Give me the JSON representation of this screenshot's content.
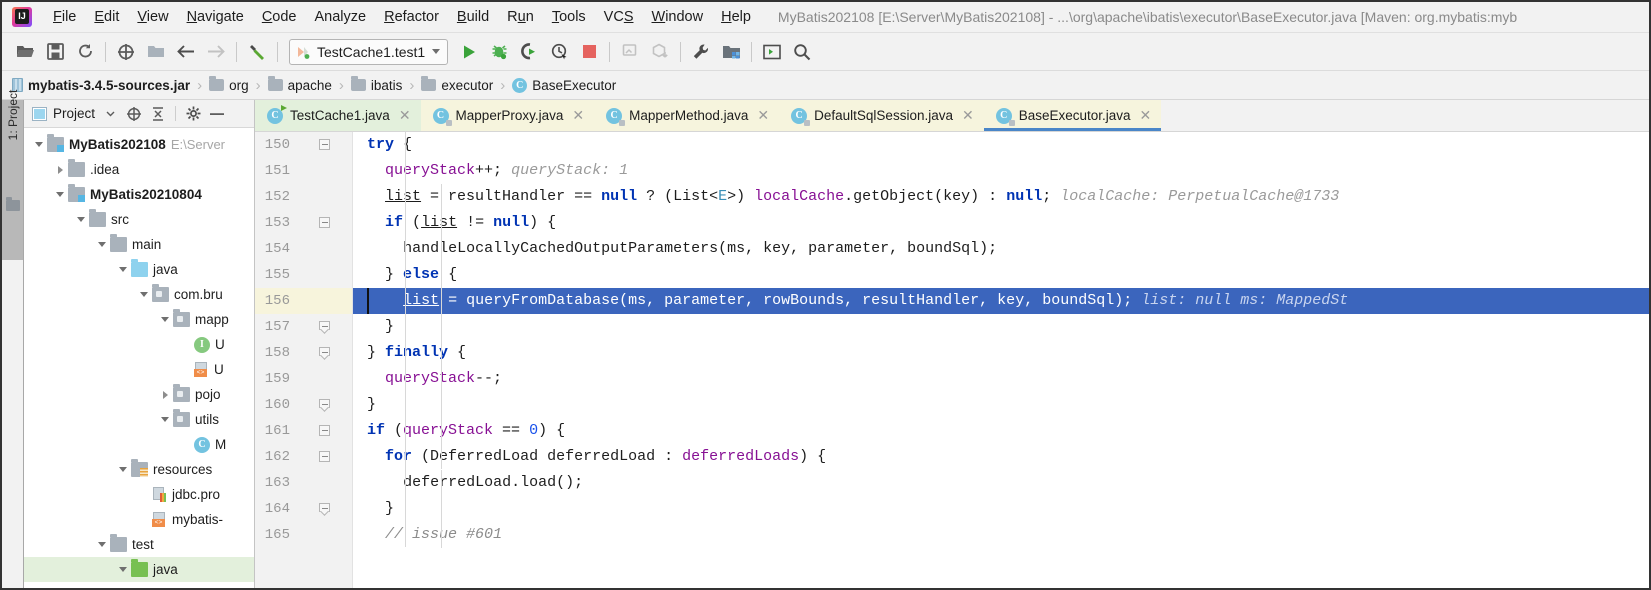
{
  "window": {
    "title": "MyBatis202108 [E:\\Server\\MyBatis202108] - ...\\org\\apache\\ibatis\\executor\\BaseExecutor.java [Maven: org.mybatis:myb",
    "logo_letters": "IJ"
  },
  "menubar": {
    "items": [
      {
        "label": "File",
        "mnemonic": "F"
      },
      {
        "label": "Edit",
        "mnemonic": "E"
      },
      {
        "label": "View",
        "mnemonic": "V"
      },
      {
        "label": "Navigate",
        "mnemonic": "N"
      },
      {
        "label": "Code",
        "mnemonic": "C"
      },
      {
        "label": "Analyze",
        "mnemonic": ""
      },
      {
        "label": "Refactor",
        "mnemonic": "R"
      },
      {
        "label": "Build",
        "mnemonic": "B"
      },
      {
        "label": "Run",
        "mnemonic": "u"
      },
      {
        "label": "Tools",
        "mnemonic": "T"
      },
      {
        "label": "VCS",
        "mnemonic": "S"
      },
      {
        "label": "Window",
        "mnemonic": "W"
      },
      {
        "label": "Help",
        "mnemonic": "H"
      }
    ]
  },
  "toolbar": {
    "icons": [
      "open-folder-icon",
      "save-all-icon",
      "sync-icon",
      "target-icon",
      "folder-icon",
      "back-arrow-icon",
      "forward-arrow-icon",
      "build-hammer-icon"
    ],
    "run_config": {
      "label": "TestCache1.test1",
      "icon": "run-config-icon"
    },
    "right_icons": [
      "run-icon",
      "debug-icon",
      "run-with-coverage-icon",
      "profile-icon",
      "stop-icon",
      "update-app-icon",
      "package-download-icon",
      "settings-wrench-icon",
      "project-structure-icon",
      "terminal-icon",
      "search-icon"
    ]
  },
  "breadcrumb": {
    "items": [
      {
        "label": "mybatis-3.4.5-sources.jar",
        "icon": "jar-icon"
      },
      {
        "label": "org",
        "icon": "folder-icon"
      },
      {
        "label": "apache",
        "icon": "folder-icon"
      },
      {
        "label": "ibatis",
        "icon": "folder-icon"
      },
      {
        "label": "executor",
        "icon": "folder-icon"
      },
      {
        "label": "BaseExecutor",
        "icon": "class-icon"
      }
    ],
    "separator": "›"
  },
  "left_strip": {
    "project_tab": "1: Project",
    "favorites_icon": "folder-icon"
  },
  "project_panel": {
    "title": "Project",
    "icons": [
      "project-view-icon",
      "locate-icon",
      "collapse-all-icon",
      "gear-icon",
      "minimize-icon"
    ],
    "tree": [
      {
        "indent": 0,
        "arrow": "down",
        "icon": "module-icon",
        "label": "MyBatis202108",
        "bold": true,
        "path": "E:\\Server",
        "selected": false
      },
      {
        "indent": 1,
        "arrow": "right",
        "icon": "folder-icon",
        "label": ".idea",
        "bold": false,
        "path": "",
        "selected": false
      },
      {
        "indent": 1,
        "arrow": "down",
        "icon": "module-icon",
        "label": "MyBatis20210804",
        "bold": true,
        "path": "",
        "selected": false
      },
      {
        "indent": 2,
        "arrow": "down",
        "icon": "folder-icon",
        "label": "src",
        "bold": false,
        "path": "",
        "selected": false
      },
      {
        "indent": 3,
        "arrow": "down",
        "icon": "folder-icon",
        "label": "main",
        "bold": false,
        "path": "",
        "selected": false
      },
      {
        "indent": 4,
        "arrow": "down",
        "icon": "source-root-icon",
        "label": "java",
        "bold": false,
        "path": "",
        "selected": false
      },
      {
        "indent": 5,
        "arrow": "down",
        "icon": "package-icon",
        "label": "com.bru",
        "bold": false,
        "path": "",
        "selected": false
      },
      {
        "indent": 6,
        "arrow": "down",
        "icon": "package-icon",
        "label": "mapp",
        "bold": false,
        "path": "",
        "selected": false
      },
      {
        "indent": 7,
        "arrow": "none",
        "icon": "interface-icon",
        "label": "U",
        "bold": false,
        "path": "",
        "selected": false
      },
      {
        "indent": 7,
        "arrow": "none",
        "icon": "xml-file-icon",
        "label": "U",
        "bold": false,
        "path": "",
        "selected": false
      },
      {
        "indent": 6,
        "arrow": "right",
        "icon": "package-icon",
        "label": "pojo",
        "bold": false,
        "path": "",
        "selected": false
      },
      {
        "indent": 6,
        "arrow": "down",
        "icon": "package-icon",
        "label": "utils",
        "bold": false,
        "path": "",
        "selected": false
      },
      {
        "indent": 7,
        "arrow": "none",
        "icon": "class-icon",
        "label": "M",
        "bold": false,
        "path": "",
        "selected": false
      },
      {
        "indent": 4,
        "arrow": "down",
        "icon": "resource-root-icon",
        "label": "resources",
        "bold": false,
        "path": "",
        "selected": false
      },
      {
        "indent": 5,
        "arrow": "none",
        "icon": "properties-file-icon",
        "label": "jdbc.pro",
        "bold": false,
        "path": "",
        "selected": false
      },
      {
        "indent": 5,
        "arrow": "none",
        "icon": "xml-file-icon",
        "label": "mybatis-",
        "bold": false,
        "path": "",
        "selected": false
      },
      {
        "indent": 3,
        "arrow": "down",
        "icon": "folder-icon",
        "label": "test",
        "bold": false,
        "path": "",
        "selected": false
      },
      {
        "indent": 4,
        "arrow": "down",
        "icon": "test-source-root-icon",
        "label": "java",
        "bold": false,
        "path": "",
        "selected": true
      }
    ]
  },
  "editor_tabs": [
    {
      "label": "TestCache1.java",
      "icon": "test-class-icon",
      "closable": true,
      "state": "green",
      "active": false
    },
    {
      "label": "MapperProxy.java",
      "icon": "readonly-class-icon",
      "closable": true,
      "state": "yellow",
      "active": false
    },
    {
      "label": "MapperMethod.java",
      "icon": "readonly-class-icon",
      "closable": true,
      "state": "yellow",
      "active": false
    },
    {
      "label": "DefaultSqlSession.java",
      "icon": "readonly-class-icon",
      "closable": true,
      "state": "yellow",
      "active": false
    },
    {
      "label": "BaseExecutor.java",
      "icon": "readonly-class-icon",
      "closable": true,
      "state": "yellow",
      "active": true
    }
  ],
  "code": {
    "first_line": 150,
    "highlighted_line": 156,
    "lines": [
      {
        "n": 150,
        "fold": "start",
        "text": "try {"
      },
      {
        "n": 151,
        "fold": "",
        "text": "  queryStack++;   queryStack: 1"
      },
      {
        "n": 152,
        "fold": "",
        "text": "  list = resultHandler == null ? (List<E>) localCache.getObject(key) : null;   localCache: PerpetualCache@1733"
      },
      {
        "n": 153,
        "fold": "start",
        "text": "  if (list != null) {"
      },
      {
        "n": 154,
        "fold": "",
        "text": "    handleLocallyCachedOutputParameters(ms, key, parameter, boundSql);"
      },
      {
        "n": 155,
        "fold": "",
        "text": "  } else {"
      },
      {
        "n": 156,
        "fold": "",
        "text": "    list = queryFromDatabase(ms, parameter, rowBounds, resultHandler, key, boundSql);   list: null  ms: MappedSt"
      },
      {
        "n": 157,
        "fold": "end",
        "text": "  }"
      },
      {
        "n": 158,
        "fold": "end",
        "text": "} finally {"
      },
      {
        "n": 159,
        "fold": "",
        "text": "  queryStack--;"
      },
      {
        "n": 160,
        "fold": "end",
        "text": "}"
      },
      {
        "n": 161,
        "fold": "start",
        "text": "if (queryStack == 0) {"
      },
      {
        "n": 162,
        "fold": "start",
        "text": "  for (DeferredLoad deferredLoad : deferredLoads) {"
      },
      {
        "n": 163,
        "fold": "",
        "text": "    deferredLoad.load();"
      },
      {
        "n": 164,
        "fold": "end",
        "text": "  }"
      },
      {
        "n": 165,
        "fold": "",
        "text": "  // issue #601"
      }
    ],
    "debug_hints": {
      "line151": "queryStack: 1",
      "line152": "localCache: PerpetualCache@1733",
      "line156": "list: null   ms: MappedSt"
    }
  },
  "colors": {
    "keyword": "#0033b3",
    "field": "#871094",
    "number": "#1750eb",
    "generic": "#3a8fb7",
    "comment": "#8c8c8c",
    "selection": "#3b65bd",
    "tab_active": "#f6f4dd",
    "tree_selection": "#e3f0dc"
  }
}
